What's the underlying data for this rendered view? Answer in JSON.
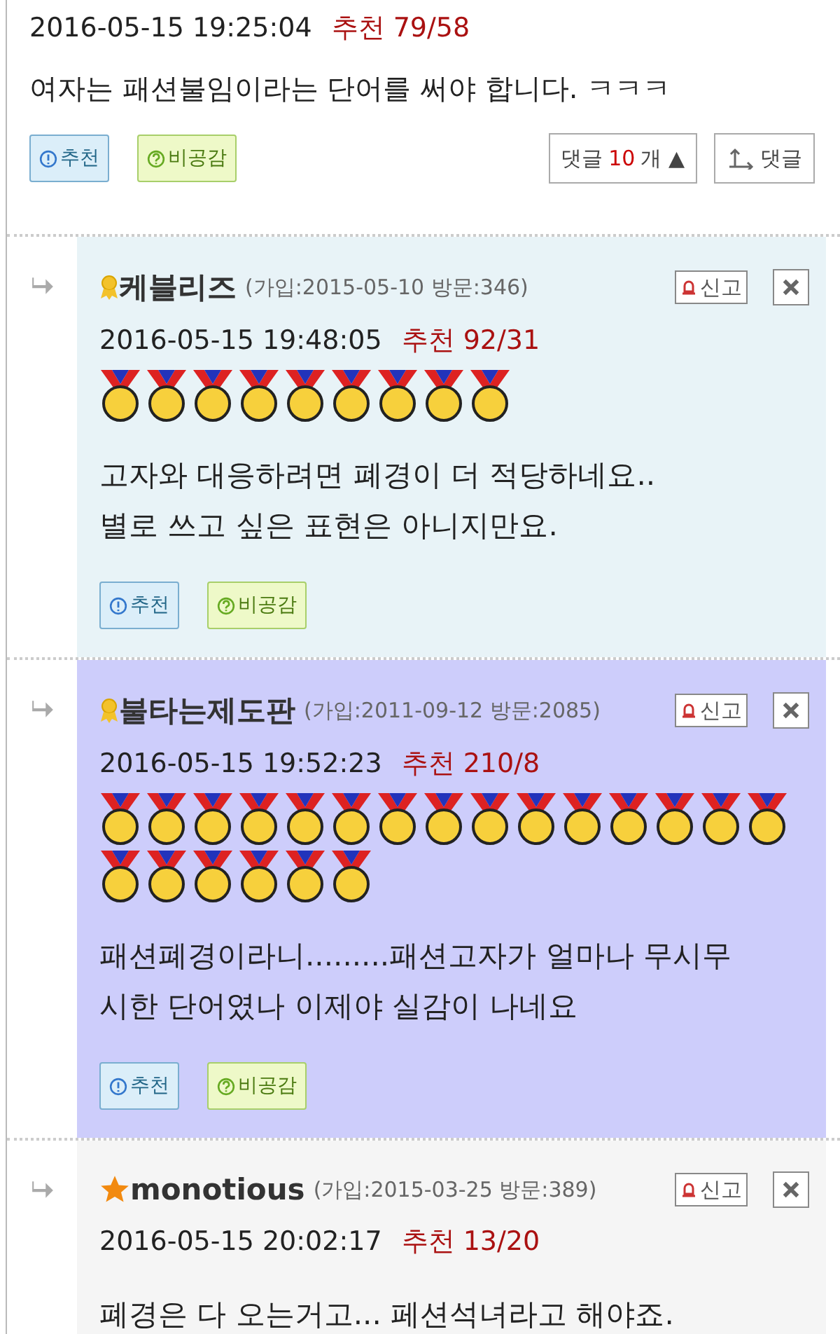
{
  "post": {
    "date": "2016-05-15 19:25:04",
    "recommend": "추천 79/58",
    "text": "여자는 패션불임이라는 단어를 써야 합니다. ㅋㅋㅋ",
    "buttons": [
      {
        "kind": "recommend",
        "label": "추천"
      },
      {
        "kind": "disagree",
        "label": "비공감"
      }
    ],
    "comment_toggle": {
      "label": "댓글",
      "count": "10",
      "unit": "개",
      "arrow": "▲"
    },
    "reply_button": "댓글"
  },
  "comments": [
    {
      "kind": "ribbon",
      "name": "케블리즈",
      "meta": "(가입:2015-05-10 방문:346)",
      "report": "신고",
      "date": "2016-05-15 19:48:05",
      "recommend": "추천 92/31",
      "medals": [
        {
          "kind": "gold"
        },
        {
          "kind": "gold"
        },
        {
          "kind": "gold"
        },
        {
          "kind": "gold"
        },
        {
          "kind": "gold"
        },
        {
          "kind": "gold"
        },
        {
          "kind": "gold"
        },
        {
          "kind": "gold"
        },
        {
          "kind": "gold"
        }
      ],
      "color": "#e8f3f7",
      "text": [
        "고자와 대응하려면 폐경이 더 적당하네요..",
        "별로 쓰고 싶은 표현은 아니지만요."
      ],
      "buttons": [
        {
          "kind": "recommend",
          "label": "추천"
        },
        {
          "kind": "disagree",
          "label": "비공감"
        }
      ]
    },
    {
      "kind": "ribbon",
      "name": "불타는제도판",
      "meta": "(가입:2011-09-12 방문:2085)",
      "report": "신고",
      "date": "2016-05-15 19:52:23",
      "recommend": "추천 210/8",
      "medals": [
        {
          "kind": "gold"
        },
        {
          "kind": "gold"
        },
        {
          "kind": "gold"
        },
        {
          "kind": "gold"
        },
        {
          "kind": "gold"
        },
        {
          "kind": "gold"
        },
        {
          "kind": "gold"
        },
        {
          "kind": "gold"
        },
        {
          "kind": "gold"
        },
        {
          "kind": "gold"
        },
        {
          "kind": "gold"
        },
        {
          "kind": "gold"
        },
        {
          "kind": "gold"
        },
        {
          "kind": "gold"
        },
        {
          "kind": "gold"
        },
        {
          "kind": "gold"
        },
        {
          "kind": "gold"
        },
        {
          "kind": "gold"
        },
        {
          "kind": "gold"
        },
        {
          "kind": "gold"
        },
        {
          "kind": "gold"
        }
      ],
      "color": "#cdcdfb",
      "text": [
        "패션폐경이라니.........패션고자가 얼마나 무시무",
        "시한 단어였나 이제야 실감이 나네요"
      ],
      "buttons": [
        {
          "kind": "recommend",
          "label": "추천"
        },
        {
          "kind": "disagree",
          "label": "비공감"
        }
      ]
    },
    {
      "kind": "star",
      "name": "monotious",
      "meta": "(가입:2015-03-25 방문:389)",
      "report": "신고",
      "date": "2016-05-15 20:02:17",
      "recommend": "추천 13/20",
      "color": "#f5f5f5",
      "text": [
        "폐경은 다 오는거고... 페션석녀라고 해야죠."
      ]
    }
  ]
}
